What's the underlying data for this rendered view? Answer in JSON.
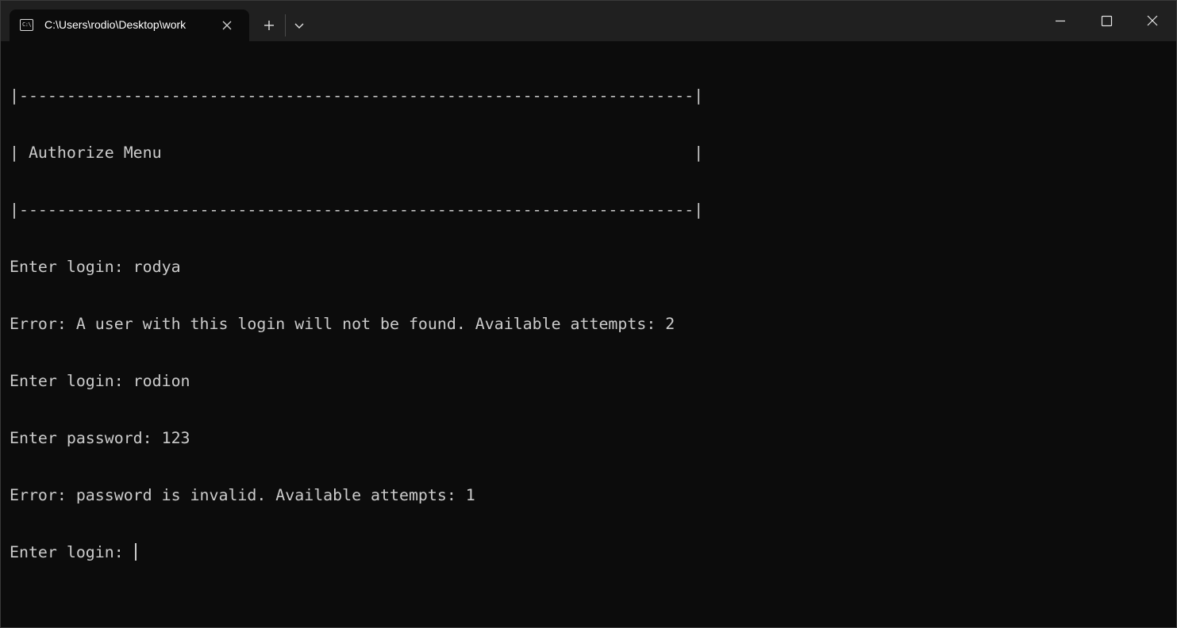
{
  "window": {
    "tab_title": "C:\\Users\\rodio\\Desktop\\work",
    "tab_icon": "terminal-icon",
    "tab_icon_text": "C:\\",
    "icons": {
      "close_tab": "close-icon",
      "new_tab": "plus-icon",
      "dropdown": "chevron-down-icon",
      "minimize": "minimize-icon",
      "maximize": "maximize-icon",
      "close_window": "close-icon"
    }
  },
  "terminal": {
    "lines": [
      "|-----------------------------------------------------------------------|",
      "| Authorize Menu                                                        |",
      "|-----------------------------------------------------------------------|",
      "Enter login: rodya",
      "Error: A user with this login will not be found. Available attempts: 2",
      "Enter login: rodion",
      "Enter password: 123",
      "Error: password is invalid. Available attempts: 1",
      "Enter login: "
    ]
  },
  "colors": {
    "background": "#0c0c0c",
    "titlebar": "#202020",
    "text": "#cccccc"
  }
}
